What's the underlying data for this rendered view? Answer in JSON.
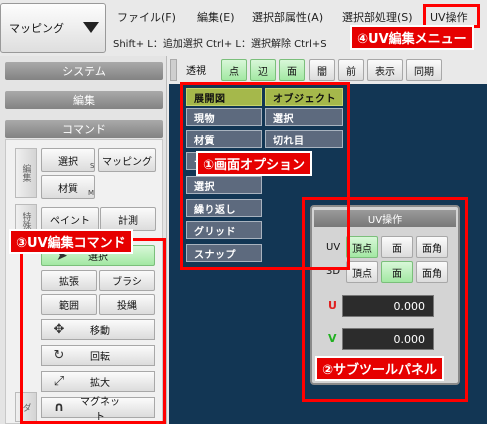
{
  "topbar": {
    "mode_label": "マッピング"
  },
  "menu": {
    "items": [
      {
        "label": "ファイル(F)"
      },
      {
        "label": "編集(E)"
      },
      {
        "label": "選択部属性(A)"
      },
      {
        "label": "選択部処理(S)"
      },
      {
        "label": "UV操作"
      }
    ],
    "shortcut_hint": "Shift+ L：追加選択 Ctrl+ L：選択解除 Ctrl+S"
  },
  "toolbar": {
    "view_label": "透視",
    "buttons": [
      {
        "label": "点",
        "active": true
      },
      {
        "label": "辺",
        "active": true
      },
      {
        "label": "面",
        "active": true
      },
      {
        "label": "闇",
        "active": false
      },
      {
        "label": "前",
        "active": false
      },
      {
        "label": "表示",
        "active": false
      },
      {
        "label": "同期",
        "active": false
      }
    ]
  },
  "left_panel": {
    "system_label": "システム",
    "edit_label": "編集",
    "command_label": "コマンド",
    "tabs": {
      "edit": "編集",
      "special": "特殊",
      "other": "ダ"
    },
    "edit_buttons": [
      {
        "label": "選択",
        "sub": "S"
      },
      {
        "label": "マッピング"
      },
      {
        "label": "材質",
        "sub": "M"
      }
    ],
    "special_buttons": [
      {
        "label": "ペイント"
      },
      {
        "label": "計測"
      }
    ],
    "select_button": "選択",
    "grid_buttons": [
      {
        "label": "拡張"
      },
      {
        "label": "ブラシ"
      },
      {
        "label": "範囲"
      },
      {
        "label": "投縄"
      }
    ],
    "icon_buttons": [
      {
        "label": "移動",
        "icon": "move-icon"
      },
      {
        "label": "回転",
        "icon": "rotate-icon"
      },
      {
        "label": "拡大",
        "icon": "scale-icon"
      },
      {
        "label": "マグネット",
        "icon": "magnet-icon"
      }
    ]
  },
  "screen_options": [
    {
      "label": "展開図",
      "active": true
    },
    {
      "label": "オブジェクト",
      "active": true
    },
    {
      "label": "現物",
      "active": false
    },
    {
      "label": "選択",
      "active": false
    },
    {
      "label": "材質",
      "active": false
    },
    {
      "label": "切れ目",
      "active": false
    },
    {
      "label": "テ",
      "active": false
    },
    {
      "label": "選択",
      "active": false
    },
    {
      "label": "繰り返し",
      "active": false
    },
    {
      "label": "グリッド",
      "active": false
    },
    {
      "label": "スナップ",
      "active": false
    }
  ],
  "subtool": {
    "title": "UV操作",
    "uv_label": "UV",
    "uv_buttons": [
      {
        "label": "頂点",
        "active": true
      },
      {
        "label": "面",
        "active": false
      },
      {
        "label": "面角",
        "active": false
      }
    ],
    "d3_label": "3D",
    "d3_buttons": [
      {
        "label": "頂点",
        "active": false
      },
      {
        "label": "面",
        "active": true
      },
      {
        "label": "面角",
        "active": false
      }
    ],
    "u_label": "U",
    "u_value": "0.000",
    "v_label": "V",
    "v_value": "0.000"
  },
  "annotations": {
    "screen_option": "①画面オプション",
    "subtool_panel": "②サブツールパネル",
    "uv_command": "③UV編集コマンド",
    "uv_menu": "④UV編集メニュー"
  },
  "colors": {
    "viewport": "#123654",
    "highlight_red": "#ff0000",
    "active_green": "#a3e8a3",
    "option_active": "#a5b84b",
    "option_bg": "#5d6a7e"
  }
}
